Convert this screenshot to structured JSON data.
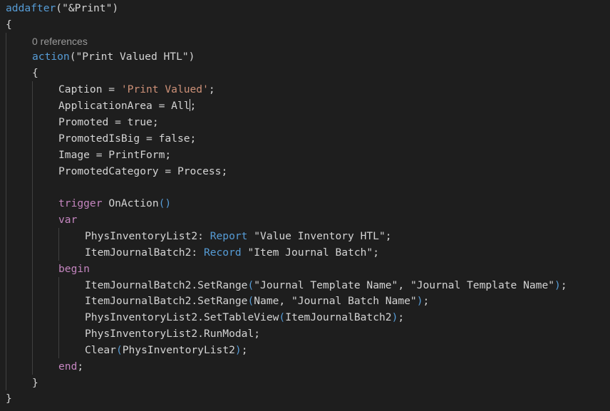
{
  "editor": {
    "language": "AL",
    "theme": {
      "background": "#1e1e1e"
    },
    "colors": {
      "keyword": "#569cd6",
      "control": "#c586c0",
      "function": "#dcdcaa",
      "string": "#ce9178",
      "type": "#4ec9b0",
      "variable": "#9cdcfe",
      "text": "#d4d4d4",
      "guide": "#404040",
      "codelens": "#999999"
    },
    "codelens": "0 references",
    "lines": [
      [
        [
          "addafter",
          "keyword"
        ],
        [
          "(",
          "text"
        ],
        [
          "\"&Print\"",
          "text"
        ],
        [
          ")",
          "text"
        ]
      ],
      [
        [
          "{",
          "text"
        ]
      ],
      [
        [
          "action",
          "keyword"
        ],
        [
          "(",
          "text"
        ],
        [
          "\"Print Valued HTL\"",
          "text"
        ],
        [
          ")",
          "text"
        ]
      ],
      [
        [
          "{",
          "text"
        ]
      ],
      [
        [
          "Caption",
          "text"
        ],
        [
          " = ",
          "text"
        ],
        [
          "'Print Valued'",
          "string"
        ],
        [
          ";",
          "text"
        ]
      ],
      [
        [
          "ApplicationArea",
          "text"
        ],
        [
          " = ",
          "text"
        ],
        [
          "All",
          "text"
        ],
        [
          "|",
          "caret"
        ],
        [
          ";",
          "text"
        ]
      ],
      [
        [
          "Promoted",
          "text"
        ],
        [
          " = ",
          "text"
        ],
        [
          "true",
          "text"
        ],
        [
          ";",
          "text"
        ]
      ],
      [
        [
          "PromotedIsBig",
          "text"
        ],
        [
          " = ",
          "text"
        ],
        [
          "false",
          "text"
        ],
        [
          ";",
          "text"
        ]
      ],
      [
        [
          "Image",
          "text"
        ],
        [
          " = ",
          "text"
        ],
        [
          "PrintForm",
          "text"
        ],
        [
          ";",
          "text"
        ]
      ],
      [
        [
          "PromotedCategory",
          "text"
        ],
        [
          " = ",
          "text"
        ],
        [
          "Process",
          "text"
        ],
        [
          ";",
          "text"
        ]
      ],
      [],
      [
        [
          "trigger",
          "control"
        ],
        [
          " ",
          "text"
        ],
        [
          "OnAction",
          "text"
        ],
        [
          "()",
          "keyword"
        ]
      ],
      [
        [
          "var",
          "control"
        ]
      ],
      [
        [
          "PhysInventoryList2",
          "text"
        ],
        [
          ": ",
          "text"
        ],
        [
          "Report",
          "keyword"
        ],
        [
          " ",
          "text"
        ],
        [
          "\"Value Inventory HTL\"",
          "text"
        ],
        [
          ";",
          "text"
        ]
      ],
      [
        [
          "ItemJournalBatch2",
          "text"
        ],
        [
          ": ",
          "text"
        ],
        [
          "Record",
          "keyword"
        ],
        [
          " ",
          "text"
        ],
        [
          "\"Item Journal Batch\"",
          "text"
        ],
        [
          ";",
          "text"
        ]
      ],
      [
        [
          "begin",
          "control"
        ]
      ],
      [
        [
          "ItemJournalBatch2",
          "text"
        ],
        [
          ".",
          "text"
        ],
        [
          "SetRange",
          "text"
        ],
        [
          "(",
          "keyword"
        ],
        [
          "\"Journal Template Name\"",
          "text"
        ],
        [
          ", ",
          "text"
        ],
        [
          "\"Journal Template Name\"",
          "text"
        ],
        [
          ")",
          "keyword"
        ],
        [
          ";",
          "text"
        ]
      ],
      [
        [
          "ItemJournalBatch2",
          "text"
        ],
        [
          ".",
          "text"
        ],
        [
          "SetRange",
          "text"
        ],
        [
          "(",
          "keyword"
        ],
        [
          "Name",
          "text"
        ],
        [
          ", ",
          "text"
        ],
        [
          "\"Journal Batch Name\"",
          "text"
        ],
        [
          ")",
          "keyword"
        ],
        [
          ";",
          "text"
        ]
      ],
      [
        [
          "PhysInventoryList2",
          "text"
        ],
        [
          ".",
          "text"
        ],
        [
          "SetTableView",
          "text"
        ],
        [
          "(",
          "keyword"
        ],
        [
          "ItemJournalBatch2",
          "text"
        ],
        [
          ")",
          "keyword"
        ],
        [
          ";",
          "text"
        ]
      ],
      [
        [
          "PhysInventoryList2",
          "text"
        ],
        [
          ".",
          "text"
        ],
        [
          "RunModal",
          "text"
        ],
        [
          ";",
          "text"
        ]
      ],
      [
        [
          "Clear",
          "text"
        ],
        [
          "(",
          "keyword"
        ],
        [
          "PhysInventoryList2",
          "text"
        ],
        [
          ")",
          "keyword"
        ],
        [
          ";",
          "text"
        ]
      ],
      [
        [
          "end",
          "control"
        ],
        [
          ";",
          "text"
        ]
      ],
      [
        [
          "}",
          "text"
        ]
      ],
      [
        [
          "}",
          "text"
        ]
      ]
    ]
  }
}
